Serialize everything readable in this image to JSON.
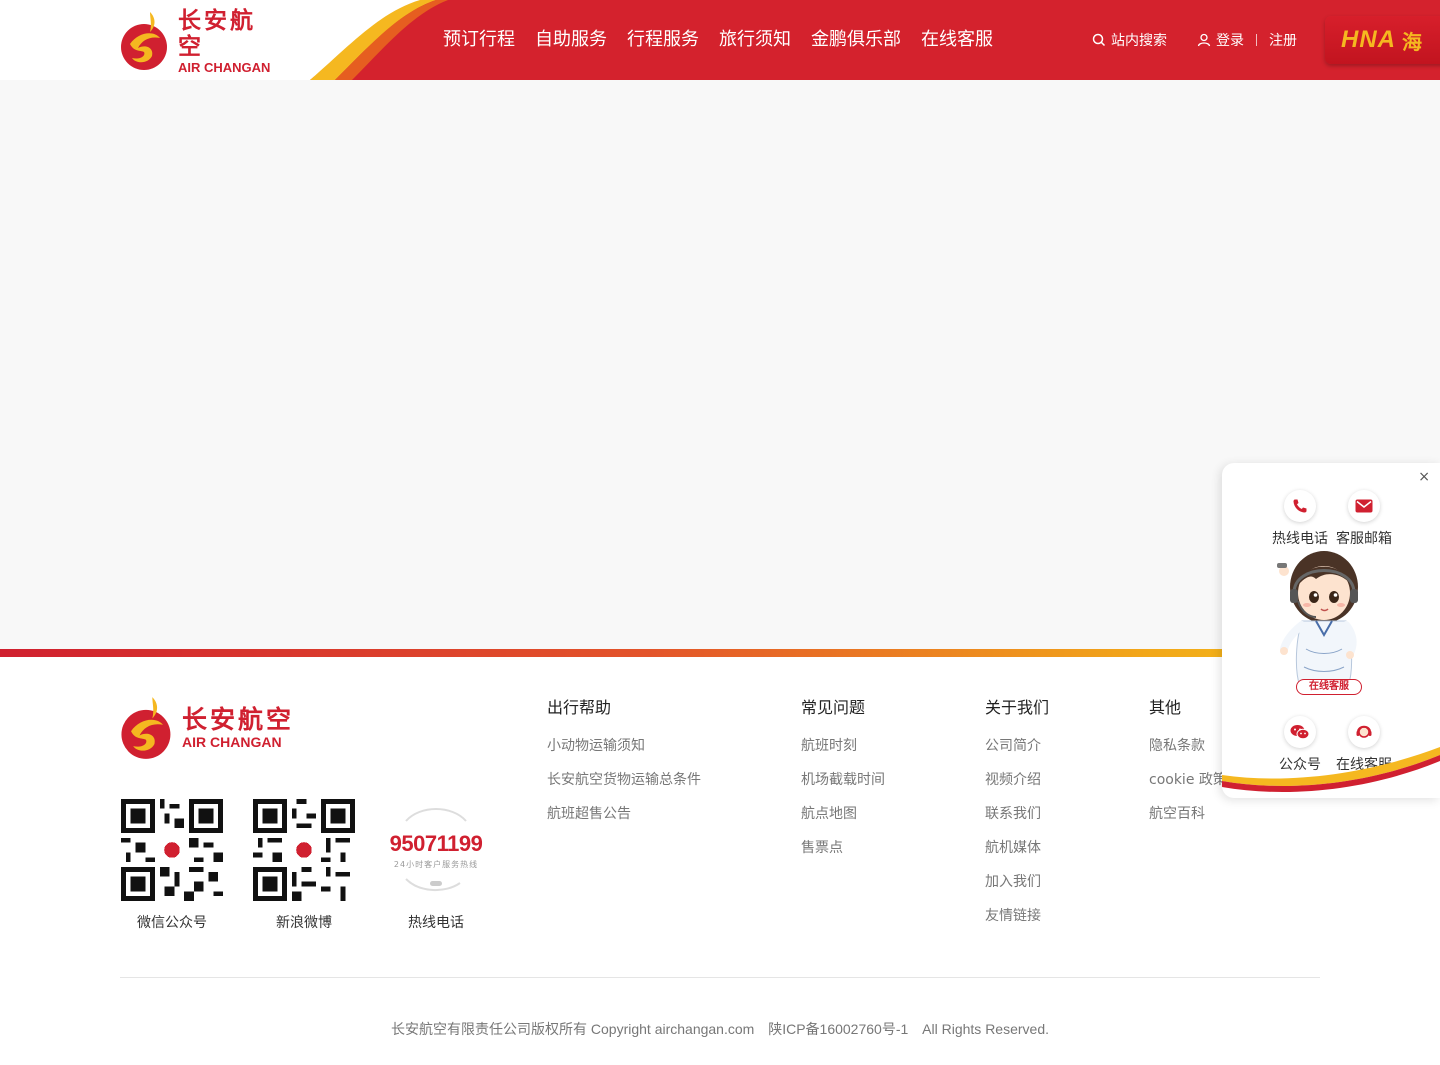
{
  "brand": {
    "name_cn": "长安航空",
    "name_en": "AIR CHANGAN"
  },
  "header": {
    "nav": [
      {
        "label": "预订行程"
      },
      {
        "label": "自助服务"
      },
      {
        "label": "行程服务"
      },
      {
        "label": "旅行须知"
      },
      {
        "label": "金鹏俱乐部"
      },
      {
        "label": "在线客服"
      }
    ],
    "search_label": "站内搜索",
    "login_label": "登录",
    "register_label": "注册",
    "partner_badge": "HNA",
    "partner_badge_cn": "海"
  },
  "colors": {
    "brand_red": "#d02030",
    "brand_gold": "#f5b820",
    "page_bg": "#f8f8f8"
  },
  "footer": {
    "qr_codes": [
      {
        "label": "微信公众号"
      },
      {
        "label": "新浪微博"
      },
      {
        "label": "热线电话"
      }
    ],
    "hotline_number": "95071199",
    "hotline_caption": "24小时客户服务热线",
    "columns": [
      {
        "title": "出行帮助",
        "links": [
          "小动物运输须知",
          "长安航空货物运输总条件",
          "航班超售公告"
        ]
      },
      {
        "title": "常见问题",
        "links": [
          "航班时刻",
          "机场截载时间",
          "航点地图",
          "售票点"
        ]
      },
      {
        "title": "关于我们",
        "links": [
          "公司简介",
          "视频介绍",
          "联系我们",
          "航机媒体",
          "加入我们",
          "友情链接"
        ]
      },
      {
        "title": "其他",
        "links": [
          "隐私条款",
          "cookie 政策",
          "航空百科"
        ]
      }
    ],
    "copyright": "长安航空有限责任公司版权所有 Copyright airchangan.com",
    "icp": "陕ICP备16002760号-1",
    "rights": "All Rights Reserved."
  },
  "widget": {
    "close_symbol": "×",
    "buttons": [
      {
        "label": "热线电话",
        "icon": "phone-icon"
      },
      {
        "label": "客服邮箱",
        "icon": "mail-icon"
      },
      {
        "label": "公众号",
        "icon": "wechat-icon"
      },
      {
        "label": "在线客服",
        "icon": "headset-icon"
      }
    ],
    "agent_badge": "在线客服"
  }
}
